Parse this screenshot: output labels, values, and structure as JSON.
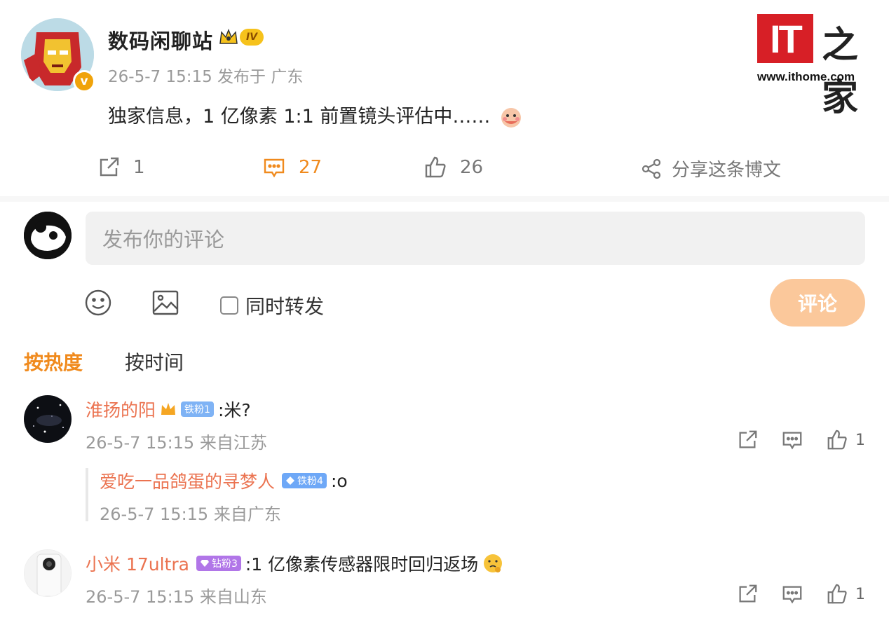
{
  "post": {
    "author": "数码闲聊站",
    "level_badge": "IV",
    "meta": "26-5-7 15:15  发布于 广东",
    "text": "独家信息，1 亿像素 1:1 前置镜头评估中……",
    "verified_mark": "v"
  },
  "logo": {
    "mark": "IT",
    "cn": "之家",
    "url": "www.ithome.com"
  },
  "actions": {
    "repost_count": "1",
    "comment_count": "27",
    "like_count": "26",
    "share_label": "分享这条博文"
  },
  "composer": {
    "placeholder": "发布你的评论",
    "repost_label": "同时转发",
    "submit_label": "评论"
  },
  "sort_tabs": {
    "hot": "按热度",
    "time": "按时间"
  },
  "comments": [
    {
      "user": "淮扬的阳",
      "badge": "铁粉1",
      "text": ":米?",
      "meta": "26-5-7 15:15 来自江苏",
      "likes": "1"
    },
    {
      "user": "爱吃一品鸽蛋的寻梦人",
      "badge": "铁粉4",
      "text": ":o",
      "meta": "26-5-7 15:15 来自广东"
    },
    {
      "user": "小米 17ultra",
      "badge": "钻粉3",
      "text": ":1 亿像素传感器限时回归返场",
      "meta": "26-5-7 15:15 来自山东",
      "likes": "1"
    }
  ],
  "colors": {
    "accent": "#f08a1d",
    "username": "#eb7350",
    "submit_bg": "#fbc89b",
    "logo_red": "#d71f26"
  },
  "icons": [
    "repost-icon",
    "comment-icon",
    "like-icon",
    "share-icon",
    "emoji-icon",
    "image-icon",
    "checkbox-icon"
  ]
}
